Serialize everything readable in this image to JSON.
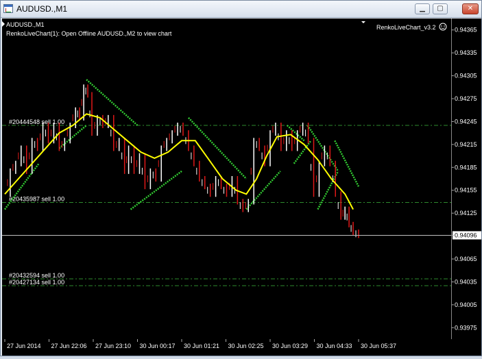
{
  "window": {
    "title": "AUDUSD.,M1",
    "buttons": {
      "minimize": "▁",
      "maximize": "▢",
      "close": "✕"
    }
  },
  "chart": {
    "symbol_label": "AUDUSD.,M1",
    "info_text": "RenkoLiveChart(1): Open Offline AUDUSD.,M2 to view chart",
    "indicator_label": "RenkoLiveChart_v3.2",
    "current_price": "0.94096",
    "orders": [
      {
        "label": "#20444548 sell 1.00",
        "price": 0.9424
      },
      {
        "label": "#20435987 sell 1.00",
        "price": 0.94139
      },
      {
        "label": "#20432594 sell 1.00",
        "price": 0.94039
      },
      {
        "label": "#20427134 sell 1.00",
        "price": 0.9403
      }
    ],
    "colors": {
      "background": "#000000",
      "order_line": "#2e8b2e",
      "bull_candle": "#ffffff",
      "bear_candle": "#e01818",
      "moving_average": "#ffff00",
      "band": "#32cd32",
      "bid_line": "#c0c0c0"
    }
  },
  "chart_data": {
    "type": "line",
    "title": "AUDUSD.,M1",
    "y_ticks": [
      "0.94365",
      "0.94335",
      "0.94305",
      "0.94275",
      "0.94245",
      "0.94215",
      "0.94185",
      "0.94155",
      "0.94125",
      "0.94096",
      "0.94065",
      "0.94035",
      "0.94005",
      "0.93975"
    ],
    "y_range": [
      0.9396,
      0.9438
    ],
    "x_ticks": [
      "27 Jun 2014",
      "27 Jun 22:06",
      "27 Jun 23:10",
      "30 Jun 00:17",
      "30 Jun 01:21",
      "30 Jun 02:25",
      "30 Jun 03:29",
      "30 Jun 04:33",
      "30 Jun 05:37"
    ],
    "x_tick_index": [
      0,
      65,
      130,
      195,
      260,
      325,
      390,
      455,
      520
    ],
    "close_series": [
      {
        "i": 0,
        "v": 0.9415
      },
      {
        "i": 8,
        "v": 0.9418
      },
      {
        "i": 16,
        "v": 0.9419
      },
      {
        "i": 24,
        "v": 0.9421
      },
      {
        "i": 32,
        "v": 0.9418
      },
      {
        "i": 40,
        "v": 0.9422
      },
      {
        "i": 48,
        "v": 0.9421
      },
      {
        "i": 56,
        "v": 0.9424
      },
      {
        "i": 64,
        "v": 0.9422
      },
      {
        "i": 72,
        "v": 0.9424
      },
      {
        "i": 80,
        "v": 0.9421
      },
      {
        "i": 88,
        "v": 0.9422
      },
      {
        "i": 96,
        "v": 0.9424
      },
      {
        "i": 104,
        "v": 0.9426
      },
      {
        "i": 110,
        "v": 0.9425
      },
      {
        "i": 116,
        "v": 0.9429
      },
      {
        "i": 122,
        "v": 0.9428
      },
      {
        "i": 128,
        "v": 0.9423
      },
      {
        "i": 136,
        "v": 0.9425
      },
      {
        "i": 144,
        "v": 0.9424
      },
      {
        "i": 152,
        "v": 0.9425
      },
      {
        "i": 160,
        "v": 0.9421
      },
      {
        "i": 168,
        "v": 0.9422
      },
      {
        "i": 176,
        "v": 0.9418
      },
      {
        "i": 182,
        "v": 0.9421
      },
      {
        "i": 190,
        "v": 0.9418
      },
      {
        "i": 198,
        "v": 0.942
      },
      {
        "i": 206,
        "v": 0.9416
      },
      {
        "i": 214,
        "v": 0.9418
      },
      {
        "i": 222,
        "v": 0.9417
      },
      {
        "i": 230,
        "v": 0.9421
      },
      {
        "i": 238,
        "v": 0.9422
      },
      {
        "i": 246,
        "v": 0.9423
      },
      {
        "i": 254,
        "v": 0.9424
      },
      {
        "i": 262,
        "v": 0.9423
      },
      {
        "i": 270,
        "v": 0.9421
      },
      {
        "i": 278,
        "v": 0.9419
      },
      {
        "i": 286,
        "v": 0.9417
      },
      {
        "i": 294,
        "v": 0.9416
      },
      {
        "i": 302,
        "v": 0.9415
      },
      {
        "i": 310,
        "v": 0.9417
      },
      {
        "i": 318,
        "v": 0.9416
      },
      {
        "i": 326,
        "v": 0.9415
      },
      {
        "i": 334,
        "v": 0.9417
      },
      {
        "i": 342,
        "v": 0.9414
      },
      {
        "i": 350,
        "v": 0.9413
      },
      {
        "i": 358,
        "v": 0.9414
      },
      {
        "i": 366,
        "v": 0.9422
      },
      {
        "i": 374,
        "v": 0.9421
      },
      {
        "i": 382,
        "v": 0.9419
      },
      {
        "i": 390,
        "v": 0.9423
      },
      {
        "i": 398,
        "v": 0.9424
      },
      {
        "i": 406,
        "v": 0.9421
      },
      {
        "i": 414,
        "v": 0.9423
      },
      {
        "i": 422,
        "v": 0.9421
      },
      {
        "i": 430,
        "v": 0.9423
      },
      {
        "i": 438,
        "v": 0.9424
      },
      {
        "i": 446,
        "v": 0.9422
      },
      {
        "i": 454,
        "v": 0.9415
      },
      {
        "i": 462,
        "v": 0.9419
      },
      {
        "i": 470,
        "v": 0.9421
      },
      {
        "i": 478,
        "v": 0.9419
      },
      {
        "i": 486,
        "v": 0.9415
      },
      {
        "i": 494,
        "v": 0.9412
      },
      {
        "i": 500,
        "v": 0.9413
      },
      {
        "i": 506,
        "v": 0.9411
      },
      {
        "i": 512,
        "v": 0.941
      },
      {
        "i": 520,
        "v": 0.94096
      }
    ],
    "ma_series": [
      {
        "i": 0,
        "v": 0.9415
      },
      {
        "i": 20,
        "v": 0.9417
      },
      {
        "i": 40,
        "v": 0.9419
      },
      {
        "i": 60,
        "v": 0.9421
      },
      {
        "i": 80,
        "v": 0.9423
      },
      {
        "i": 100,
        "v": 0.9424
      },
      {
        "i": 120,
        "v": 0.94255
      },
      {
        "i": 140,
        "v": 0.9425
      },
      {
        "i": 160,
        "v": 0.94235
      },
      {
        "i": 180,
        "v": 0.9422
      },
      {
        "i": 200,
        "v": 0.94205
      },
      {
        "i": 220,
        "v": 0.94197
      },
      {
        "i": 240,
        "v": 0.94205
      },
      {
        "i": 260,
        "v": 0.9422
      },
      {
        "i": 280,
        "v": 0.9422
      },
      {
        "i": 300,
        "v": 0.94195
      },
      {
        "i": 320,
        "v": 0.9417
      },
      {
        "i": 340,
        "v": 0.94155
      },
      {
        "i": 355,
        "v": 0.9415
      },
      {
        "i": 370,
        "v": 0.9417
      },
      {
        "i": 385,
        "v": 0.942
      },
      {
        "i": 400,
        "v": 0.94225
      },
      {
        "i": 420,
        "v": 0.94228
      },
      {
        "i": 440,
        "v": 0.94215
      },
      {
        "i": 460,
        "v": 0.94195
      },
      {
        "i": 480,
        "v": 0.9417
      },
      {
        "i": 500,
        "v": 0.9415
      },
      {
        "i": 512,
        "v": 0.9413
      }
    ],
    "band_segments": [
      [
        {
          "i": 0,
          "v": 0.9413
        },
        {
          "i": 50,
          "v": 0.9419
        }
      ],
      [
        {
          "i": 80,
          "v": 0.9421
        },
        {
          "i": 120,
          "v": 0.9424
        }
      ],
      [
        {
          "i": 120,
          "v": 0.943
        },
        {
          "i": 195,
          "v": 0.9424
        }
      ],
      [
        {
          "i": 185,
          "v": 0.9413
        },
        {
          "i": 260,
          "v": 0.9418
        }
      ],
      [
        {
          "i": 270,
          "v": 0.9425
        },
        {
          "i": 355,
          "v": 0.9417
        }
      ],
      [
        {
          "i": 355,
          "v": 0.9413
        },
        {
          "i": 405,
          "v": 0.9418
        }
      ],
      [
        {
          "i": 415,
          "v": 0.9424
        },
        {
          "i": 440,
          "v": 0.9422
        }
      ],
      [
        {
          "i": 425,
          "v": 0.9419
        },
        {
          "i": 450,
          "v": 0.9422
        }
      ],
      [
        {
          "i": 445,
          "v": 0.9424
        },
        {
          "i": 490,
          "v": 0.9418
        }
      ],
      [
        {
          "i": 460,
          "v": 0.9413
        },
        {
          "i": 490,
          "v": 0.9418
        }
      ],
      [
        {
          "i": 485,
          "v": 0.9422
        },
        {
          "i": 520,
          "v": 0.9416
        }
      ]
    ]
  }
}
